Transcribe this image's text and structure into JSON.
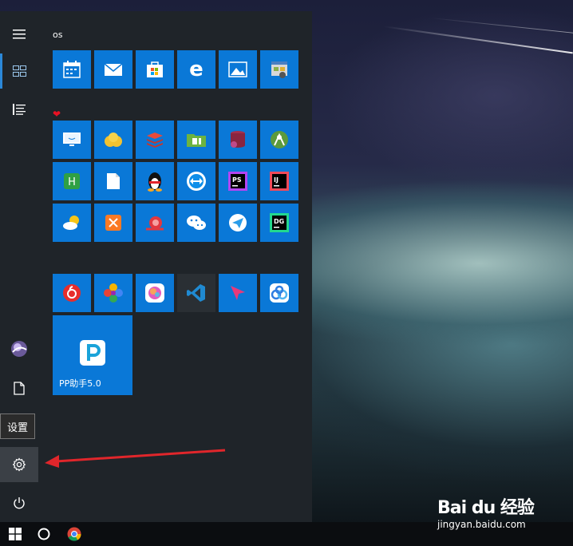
{
  "start_menu": {
    "group1_title": "os",
    "tooltip": "设置",
    "big_tile_label": "PP助手5.0"
  },
  "taskbar": {
    "start_icon": "windows-logo-icon",
    "search_icon": "cortana-circle-icon",
    "pinned": [
      "chrome-icon"
    ]
  },
  "watermark": {
    "logo": "Bai du 经验",
    "url": "jingyan.baidu.com"
  },
  "colors": {
    "tile_blue": "#0a78d7",
    "accent": "#2b88d8",
    "menu_bg": "#1f2429",
    "arrow": "#e0262b"
  }
}
